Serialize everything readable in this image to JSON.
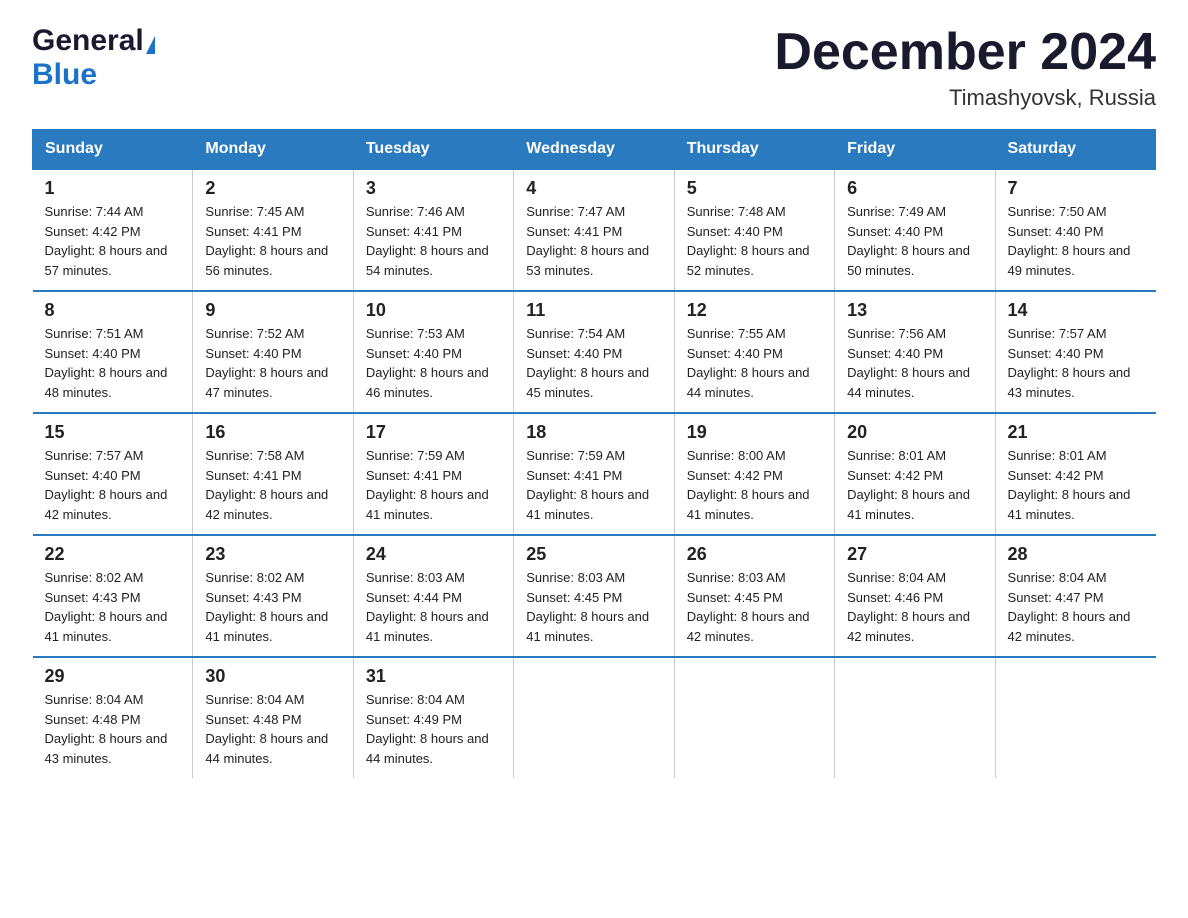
{
  "logo": {
    "general": "General",
    "blue": "Blue"
  },
  "header": {
    "title": "December 2024",
    "subtitle": "Timashyovsk, Russia"
  },
  "days_of_week": [
    "Sunday",
    "Monday",
    "Tuesday",
    "Wednesday",
    "Thursday",
    "Friday",
    "Saturday"
  ],
  "weeks": [
    [
      {
        "num": "1",
        "sunrise": "7:44 AM",
        "sunset": "4:42 PM",
        "daylight": "8 hours and 57 minutes."
      },
      {
        "num": "2",
        "sunrise": "7:45 AM",
        "sunset": "4:41 PM",
        "daylight": "8 hours and 56 minutes."
      },
      {
        "num": "3",
        "sunrise": "7:46 AM",
        "sunset": "4:41 PM",
        "daylight": "8 hours and 54 minutes."
      },
      {
        "num": "4",
        "sunrise": "7:47 AM",
        "sunset": "4:41 PM",
        "daylight": "8 hours and 53 minutes."
      },
      {
        "num": "5",
        "sunrise": "7:48 AM",
        "sunset": "4:40 PM",
        "daylight": "8 hours and 52 minutes."
      },
      {
        "num": "6",
        "sunrise": "7:49 AM",
        "sunset": "4:40 PM",
        "daylight": "8 hours and 50 minutes."
      },
      {
        "num": "7",
        "sunrise": "7:50 AM",
        "sunset": "4:40 PM",
        "daylight": "8 hours and 49 minutes."
      }
    ],
    [
      {
        "num": "8",
        "sunrise": "7:51 AM",
        "sunset": "4:40 PM",
        "daylight": "8 hours and 48 minutes."
      },
      {
        "num": "9",
        "sunrise": "7:52 AM",
        "sunset": "4:40 PM",
        "daylight": "8 hours and 47 minutes."
      },
      {
        "num": "10",
        "sunrise": "7:53 AM",
        "sunset": "4:40 PM",
        "daylight": "8 hours and 46 minutes."
      },
      {
        "num": "11",
        "sunrise": "7:54 AM",
        "sunset": "4:40 PM",
        "daylight": "8 hours and 45 minutes."
      },
      {
        "num": "12",
        "sunrise": "7:55 AM",
        "sunset": "4:40 PM",
        "daylight": "8 hours and 44 minutes."
      },
      {
        "num": "13",
        "sunrise": "7:56 AM",
        "sunset": "4:40 PM",
        "daylight": "8 hours and 44 minutes."
      },
      {
        "num": "14",
        "sunrise": "7:57 AM",
        "sunset": "4:40 PM",
        "daylight": "8 hours and 43 minutes."
      }
    ],
    [
      {
        "num": "15",
        "sunrise": "7:57 AM",
        "sunset": "4:40 PM",
        "daylight": "8 hours and 42 minutes."
      },
      {
        "num": "16",
        "sunrise": "7:58 AM",
        "sunset": "4:41 PM",
        "daylight": "8 hours and 42 minutes."
      },
      {
        "num": "17",
        "sunrise": "7:59 AM",
        "sunset": "4:41 PM",
        "daylight": "8 hours and 41 minutes."
      },
      {
        "num": "18",
        "sunrise": "7:59 AM",
        "sunset": "4:41 PM",
        "daylight": "8 hours and 41 minutes."
      },
      {
        "num": "19",
        "sunrise": "8:00 AM",
        "sunset": "4:42 PM",
        "daylight": "8 hours and 41 minutes."
      },
      {
        "num": "20",
        "sunrise": "8:01 AM",
        "sunset": "4:42 PM",
        "daylight": "8 hours and 41 minutes."
      },
      {
        "num": "21",
        "sunrise": "8:01 AM",
        "sunset": "4:42 PM",
        "daylight": "8 hours and 41 minutes."
      }
    ],
    [
      {
        "num": "22",
        "sunrise": "8:02 AM",
        "sunset": "4:43 PM",
        "daylight": "8 hours and 41 minutes."
      },
      {
        "num": "23",
        "sunrise": "8:02 AM",
        "sunset": "4:43 PM",
        "daylight": "8 hours and 41 minutes."
      },
      {
        "num": "24",
        "sunrise": "8:03 AM",
        "sunset": "4:44 PM",
        "daylight": "8 hours and 41 minutes."
      },
      {
        "num": "25",
        "sunrise": "8:03 AM",
        "sunset": "4:45 PM",
        "daylight": "8 hours and 41 minutes."
      },
      {
        "num": "26",
        "sunrise": "8:03 AM",
        "sunset": "4:45 PM",
        "daylight": "8 hours and 42 minutes."
      },
      {
        "num": "27",
        "sunrise": "8:04 AM",
        "sunset": "4:46 PM",
        "daylight": "8 hours and 42 minutes."
      },
      {
        "num": "28",
        "sunrise": "8:04 AM",
        "sunset": "4:47 PM",
        "daylight": "8 hours and 42 minutes."
      }
    ],
    [
      {
        "num": "29",
        "sunrise": "8:04 AM",
        "sunset": "4:48 PM",
        "daylight": "8 hours and 43 minutes."
      },
      {
        "num": "30",
        "sunrise": "8:04 AM",
        "sunset": "4:48 PM",
        "daylight": "8 hours and 44 minutes."
      },
      {
        "num": "31",
        "sunrise": "8:04 AM",
        "sunset": "4:49 PM",
        "daylight": "8 hours and 44 minutes."
      },
      null,
      null,
      null,
      null
    ]
  ],
  "labels": {
    "sunrise": "Sunrise:",
    "sunset": "Sunset:",
    "daylight": "Daylight:"
  },
  "colors": {
    "header_bg": "#2a7abf",
    "header_text": "#ffffff",
    "border": "#2a7abf"
  }
}
